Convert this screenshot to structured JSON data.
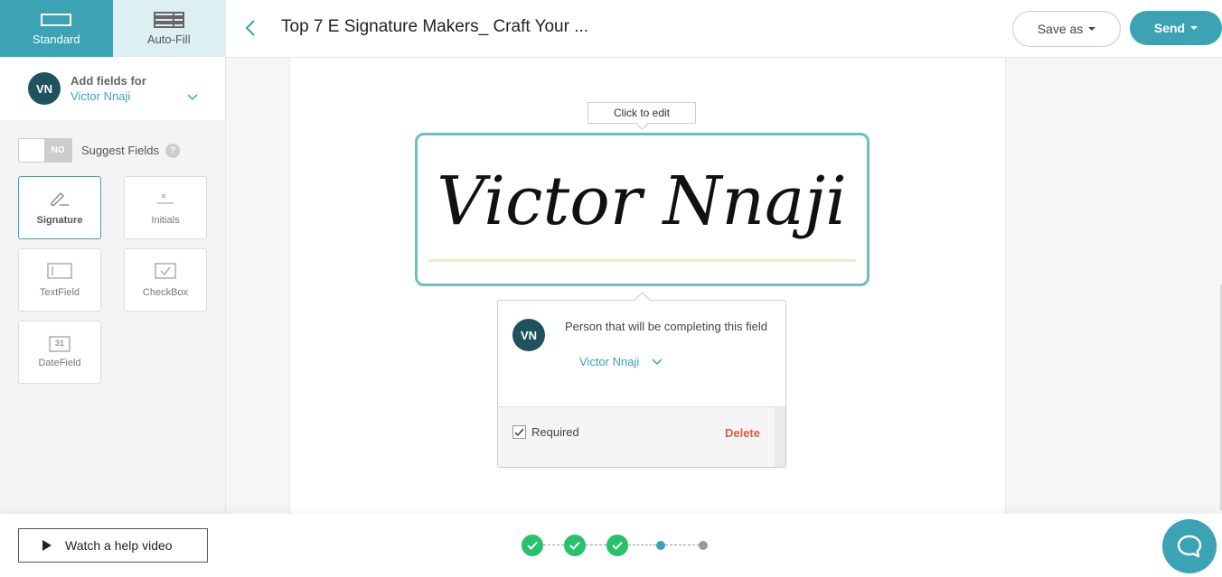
{
  "sidebar": {
    "tabs": [
      {
        "label": "Standard",
        "icon": "standard-field-icon"
      },
      {
        "label": "Auto-Fill",
        "icon": "auto-fill-icon"
      }
    ],
    "add_fields": {
      "avatar": "VN",
      "label": "Add fields for",
      "signer": "Victor Nnaji"
    },
    "suggest": {
      "toggle": "NO",
      "label": "Suggest Fields",
      "help": "?"
    },
    "fields": [
      {
        "label": "Signature",
        "icon": "signature-pen-icon"
      },
      {
        "label": "Initials",
        "icon": "initials-icon"
      },
      {
        "label": "TextField",
        "icon": "textfield-icon"
      },
      {
        "label": "CheckBox",
        "icon": "checkbox-icon"
      },
      {
        "label": "DateField",
        "icon": "calendar-icon",
        "day": "31"
      }
    ]
  },
  "header": {
    "title": "Top 7 E Signature Makers_ Craft Your ...",
    "save_as": "Save as",
    "send": "Send"
  },
  "canvas": {
    "click_to_edit": "Click to edit",
    "signature_text": "Victor Nnaji"
  },
  "popup": {
    "avatar": "VN",
    "person_label": "Person that will be completing this field",
    "assignee": "Victor Nnaji",
    "required_label": "Required",
    "required_checked": true,
    "delete_label": "Delete"
  },
  "footer": {
    "help_video": "Watch a help video",
    "steps_completed": 3,
    "steps_total": 5
  },
  "colors": {
    "accent": "#3ba3b4",
    "avatar": "#1e525c",
    "success": "#27c26a",
    "danger": "#e0584b"
  }
}
